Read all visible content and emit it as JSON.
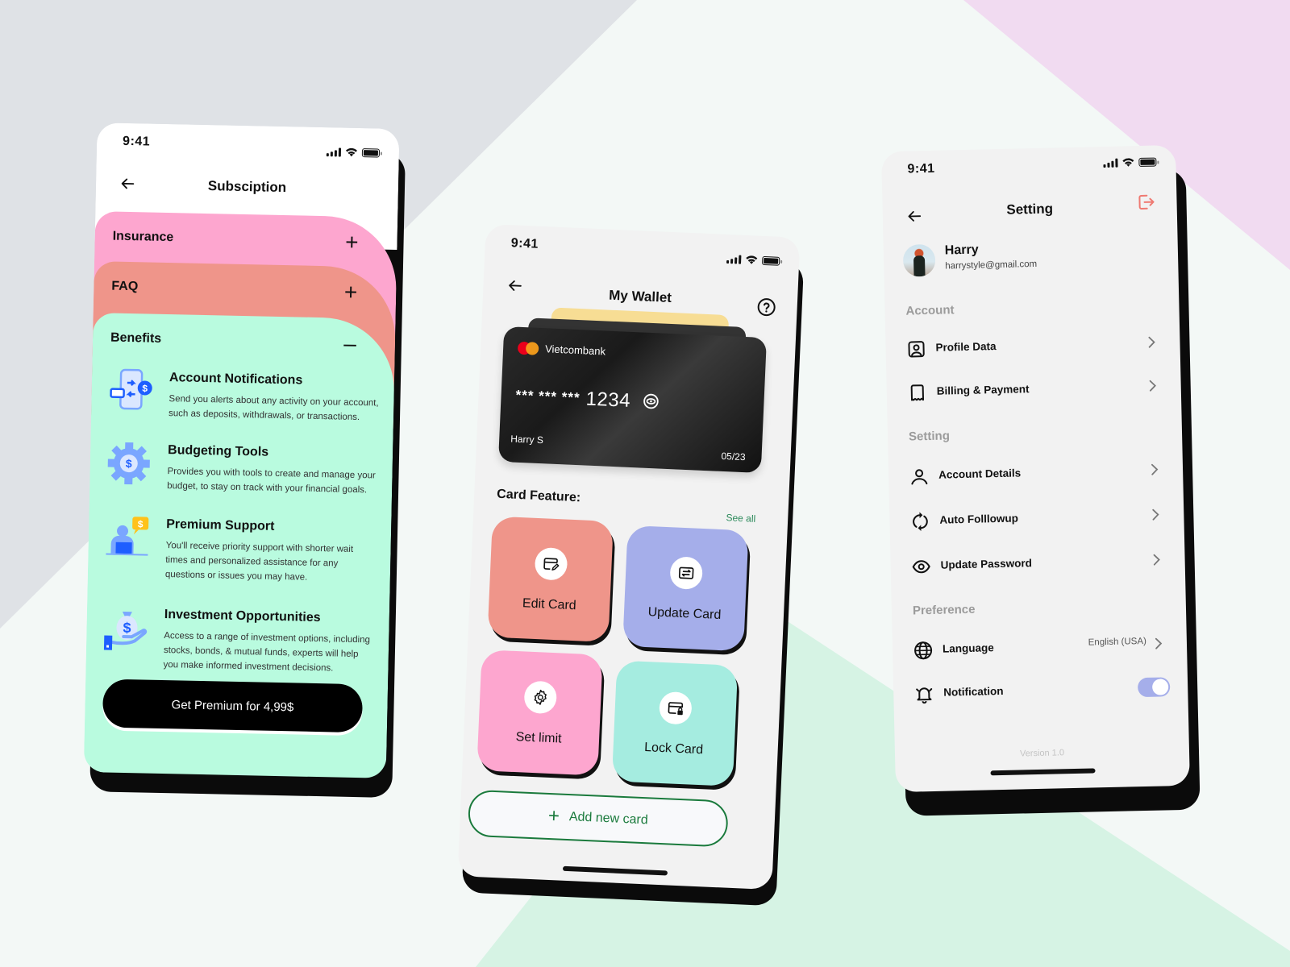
{
  "status_bar": {
    "time": "9:41"
  },
  "subscription": {
    "title": "Subsciption",
    "accordions": [
      {
        "label": "Insurance",
        "state": "collapsed",
        "toggle": "+"
      },
      {
        "label": "FAQ",
        "state": "collapsed",
        "toggle": "+"
      },
      {
        "label": "Benefits",
        "state": "expanded",
        "toggle": "–"
      }
    ],
    "benefits": [
      {
        "icon": "phone-transfer-icon",
        "title": "Account Notifications",
        "description": "Send you alerts about any activity on your account, such as deposits, withdrawals, or transactions."
      },
      {
        "icon": "gear-dollar-icon",
        "title": "Budgeting Tools",
        "description": "Provides you with tools to create and manage your budget, to stay on track with your financial goals."
      },
      {
        "icon": "support-agent-icon",
        "title": "Premium Support",
        "description": "You'll receive priority support with shorter wait times and personalized assistance for any questions or issues you may have."
      },
      {
        "icon": "money-bag-hand-icon",
        "title": "Investment Opportunities",
        "description": "Access to a range of investment options, including stocks, bonds, & mutual funds, experts will help you make informed investment decisions."
      }
    ],
    "cta_label": "Get Premium for 4,99$",
    "colors": {
      "insurance": "#fda6cf",
      "faq": "#ef958a",
      "benefits": "#b9fbdf"
    }
  },
  "wallet": {
    "title": "My Wallet",
    "card": {
      "bank": "Vietcombank",
      "number_mask": "*** *** ***",
      "number_last4": "1234",
      "holder": "Harry S",
      "expiry": "05/23",
      "network": "mastercard"
    },
    "features_title": "Card Feature:",
    "see_all_label": "See all",
    "features": [
      {
        "label": "Edit Card",
        "icon": "card-edit-icon",
        "color": "#ef958a"
      },
      {
        "label": "Update Card",
        "icon": "card-swap-icon",
        "color": "#a5aeea"
      },
      {
        "label": "Set limit",
        "icon": "gear-icon",
        "color": "#fda6cf"
      },
      {
        "label": "Lock Card",
        "icon": "card-lock-icon",
        "color": "#a5ece0"
      }
    ],
    "add_card_label": "Add new card",
    "accent": "#1a7a3c"
  },
  "settings": {
    "title": "Setting",
    "user": {
      "name": "Harry",
      "email": "harrystyle@gmail.com"
    },
    "sections": [
      {
        "label": "Account",
        "items": [
          {
            "label": "Profile Data",
            "icon": "profile-card-icon"
          },
          {
            "label": "Billing & Payment",
            "icon": "receipt-icon"
          }
        ]
      },
      {
        "label": "Setting",
        "items": [
          {
            "label": "Account Details",
            "icon": "user-icon"
          },
          {
            "label": "Auto Folllowup",
            "icon": "refresh-icon"
          },
          {
            "label": "Update Password",
            "icon": "eye-icon"
          }
        ]
      },
      {
        "label": "Preference",
        "items": [
          {
            "label": "Language",
            "icon": "globe-icon",
            "value": "English (USA)"
          },
          {
            "label": "Notification",
            "icon": "bell-ring-icon",
            "toggle_on": true
          }
        ]
      }
    ],
    "version": "Version 1.0",
    "logout_color": "#ef7a72",
    "toggle_color": "#a5aeea"
  }
}
